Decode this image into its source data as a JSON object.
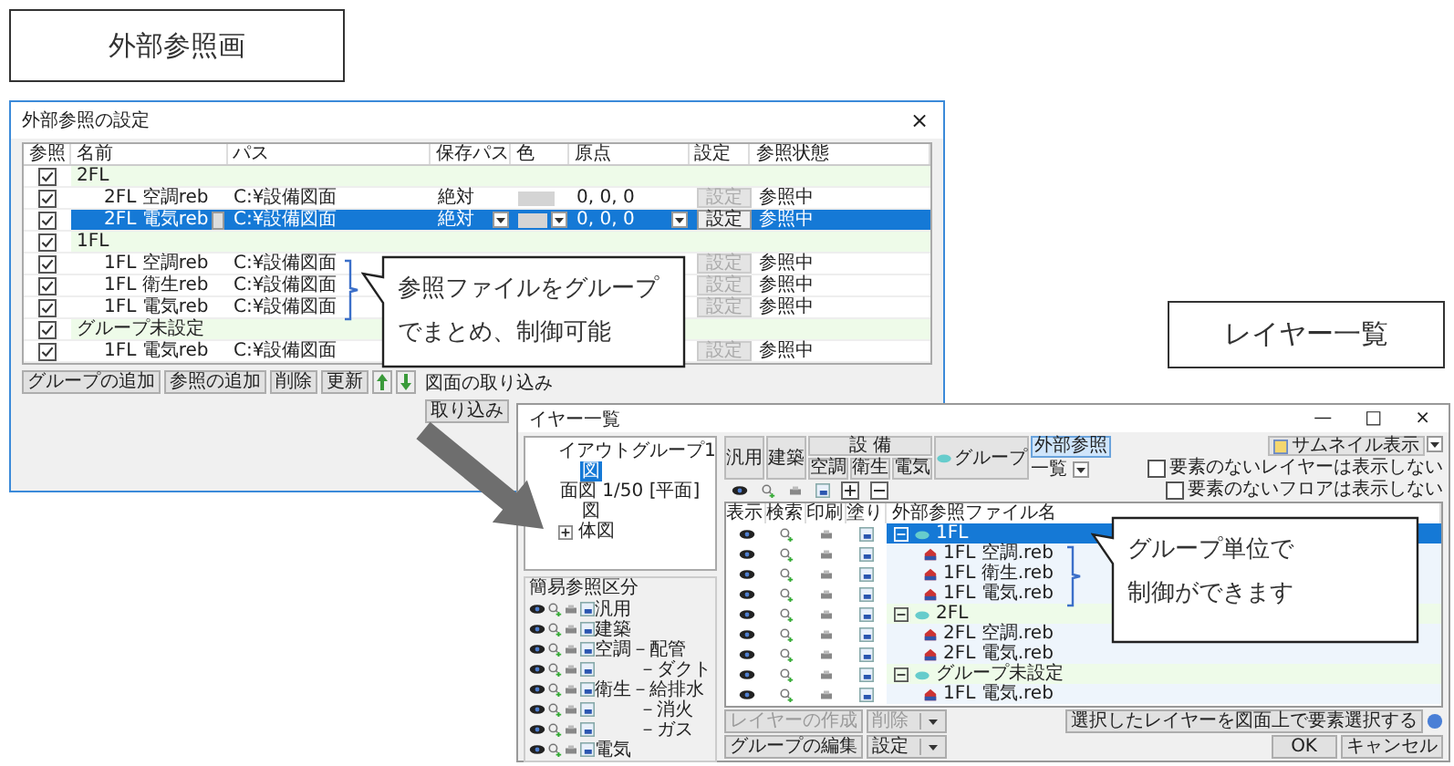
{
  "heading_label": "外部参照画",
  "layer_label": "レイヤー一覧",
  "ref_window": {
    "title": "外部参照の設定",
    "close": "×",
    "columns": [
      "参照",
      "名前",
      "パス",
      "保存パス",
      "色",
      "原点",
      "設定",
      "参照状態"
    ],
    "rows": [
      {
        "kind": "group",
        "checked": true,
        "name": "2FL"
      },
      {
        "kind": "file",
        "checked": true,
        "selected": false,
        "name": "2FL 空調reb",
        "path": "C:¥設備図面",
        "save_path": "絶対",
        "origin": "0, 0, 0",
        "setting": "設定",
        "status": "参照中"
      },
      {
        "kind": "file",
        "checked": true,
        "selected": true,
        "name": "2FL 電気reb",
        "path": "C:¥設備図面",
        "save_path": "絶対",
        "origin": "0, 0, 0",
        "setting": "設定",
        "status": "参照中"
      },
      {
        "kind": "group",
        "checked": true,
        "name": "1FL"
      },
      {
        "kind": "file",
        "checked": true,
        "selected": false,
        "name": "1FL 空調reb",
        "path": "C:¥設備図面",
        "setting": "設定",
        "status": "参照中"
      },
      {
        "kind": "file",
        "checked": true,
        "selected": false,
        "name": "1FL 衛生reb",
        "path": "C:¥設備図面",
        "setting": "設定",
        "status": "参照中"
      },
      {
        "kind": "file",
        "checked": true,
        "selected": false,
        "name": "1FL 電気reb",
        "path": "C:¥設備図面",
        "setting": "設定",
        "status": "参照中"
      },
      {
        "kind": "group",
        "checked": true,
        "name": "グループ未設定"
      },
      {
        "kind": "file",
        "checked": true,
        "selected": false,
        "name": "1FL 電気reb",
        "path": "C:¥設備図面",
        "setting": "設定",
        "status": "参照中"
      }
    ],
    "buttons": [
      "グループの追加",
      "参照の追加",
      "削除",
      "更新"
    ],
    "import_label": "図面の取り込み",
    "import_button": "取り込み"
  },
  "layer_window": {
    "title": "イヤー一覧",
    "controls": [
      "—",
      "□",
      "×"
    ],
    "tree": [
      {
        "label": "イアウトグループ1",
        "children": [
          {
            "label": "図",
            "selected": true
          },
          {
            "label": "面図 1/50 [平面]",
            "selected": false
          },
          {
            "label": "図",
            "selected": false
          },
          {
            "label": "体図",
            "selected": false,
            "expanded": false
          }
        ]
      }
    ],
    "category_title": "簡易参照区分",
    "categories": [
      {
        "label": "汎用"
      },
      {
        "label": "建築"
      },
      {
        "label": "空調－配管",
        "children": [
          {
            "label": "－ダクト"
          }
        ]
      },
      {
        "label": "衛生－給排水",
        "children": [
          {
            "label": "－消火"
          },
          {
            "label": "－ガス"
          }
        ]
      },
      {
        "label": "電気"
      }
    ],
    "tabs": [
      {
        "label": "汎用",
        "selected": false
      },
      {
        "label": "建築",
        "selected": false
      },
      {
        "label": "設 備",
        "selected": false,
        "subtabs": [
          {
            "label": "空調",
            "selected": false
          },
          {
            "label": "衛生",
            "selected": false
          },
          {
            "label": "電気",
            "selected": false
          }
        ]
      },
      {
        "label": "グループ",
        "selected": false
      },
      {
        "label": "外部参照",
        "selected": true
      }
    ],
    "view": "一覧",
    "thumbnail_button": "サムネイル表示",
    "options": [
      {
        "label": "要素のないレイヤーは表示しない",
        "checked": false
      },
      {
        "label": "要素のないフロアは表示しない",
        "checked": false
      }
    ],
    "columns": [
      "表示",
      "検索",
      "印刷",
      "塗り",
      "外部参照ファイル名"
    ],
    "rows": [
      {
        "kind": "group",
        "name": "1FL",
        "selected": true,
        "expanded": true
      },
      {
        "kind": "file",
        "name": "1FL 空調.reb",
        "selected": false
      },
      {
        "kind": "file",
        "name": "1FL 衛生.reb",
        "selected": false
      },
      {
        "kind": "file",
        "name": "1FL 電気.reb",
        "selected": false
      },
      {
        "kind": "group",
        "name": "2FL",
        "selected": false,
        "expanded": true
      },
      {
        "kind": "file",
        "name": "2FL 空調.reb",
        "selected": false
      },
      {
        "kind": "file",
        "name": "2FL 電気.reb",
        "selected": false
      },
      {
        "kind": "group",
        "name": "グループ未設定",
        "selected": false,
        "expanded": true
      },
      {
        "kind": "file",
        "name": "1FL 電気.reb",
        "selected": false
      }
    ],
    "bottom_rows": [
      [
        {
          "label": "レイヤーの作成",
          "disabled": true,
          "menu": false
        },
        {
          "label": "削除",
          "disabled": true,
          "menu": true
        }
      ],
      [
        {
          "label": "グループの編集",
          "disabled": false,
          "menu": false
        },
        {
          "label": "設定",
          "disabled": false,
          "menu": true
        }
      ]
    ],
    "select_button": "選択したレイヤーを図面上で要素選択する",
    "ok": "OK",
    "cancel": "キャンセル"
  },
  "callouts": [
    {
      "lines": [
        "参照ファイルをグループ",
        "でまとめ、制御可能"
      ]
    },
    {
      "lines": [
        "グループ単位で",
        "制御ができます"
      ]
    }
  ]
}
